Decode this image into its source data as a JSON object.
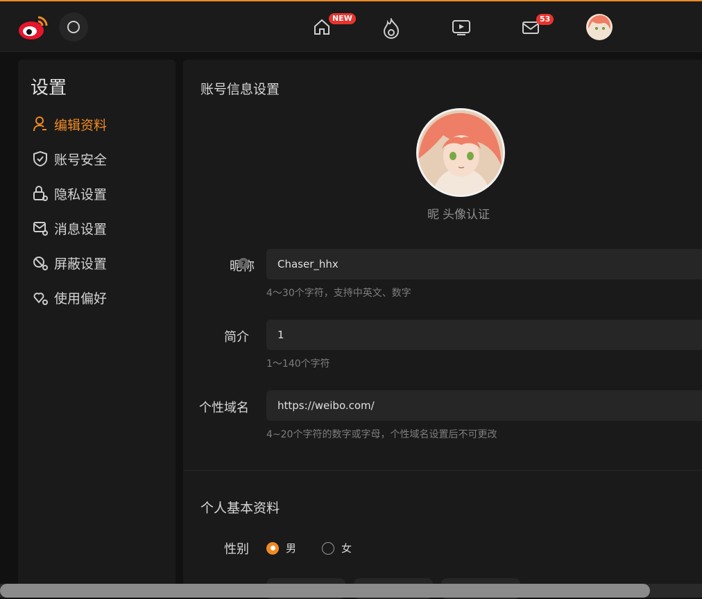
{
  "topbar": {
    "logo_icon": "weibo-logo-icon",
    "search_icon": "search-icon",
    "nav": [
      {
        "name": "home-icon",
        "badge": "NEW"
      },
      {
        "name": "hot-icon",
        "badge": ""
      },
      {
        "name": "video-icon",
        "badge": ""
      },
      {
        "name": "message-icon",
        "badge": "53"
      },
      {
        "name": "user-avatar",
        "badge": ""
      }
    ],
    "accent_color": "#f08a24",
    "badge_color": "#e8342e"
  },
  "sidebar": {
    "title": "设置",
    "items": [
      {
        "label": "编辑资料",
        "icon": "user-icon",
        "active": true
      },
      {
        "label": "账号安全",
        "icon": "shield-icon",
        "active": false
      },
      {
        "label": "隐私设置",
        "icon": "lock-gear-icon",
        "active": false
      },
      {
        "label": "消息设置",
        "icon": "mail-gear-icon",
        "active": false
      },
      {
        "label": "屏蔽设置",
        "icon": "block-gear-icon",
        "active": false
      },
      {
        "label": "使用偏好",
        "icon": "heart-gear-icon",
        "active": false
      }
    ]
  },
  "main": {
    "section_account": "账号信息设置",
    "avatar_caption_left": "昵",
    "avatar_caption": "头像认证",
    "nickname": {
      "label": "昵称",
      "value": "Chaser_hhx",
      "hint": "4～30个字符，支持中英文、数字"
    },
    "bio": {
      "label": "简介",
      "value": "1",
      "hint": "1～140个字符"
    },
    "domain": {
      "label": "个性域名",
      "prefix": "https://weibo.com/",
      "value": "",
      "hint": "4~20个字符的数字或字母，个性域名设置后不可更改"
    },
    "section_basic": "个人基本资料",
    "gender": {
      "label": "性别",
      "options": [
        "男",
        "女"
      ],
      "selected": "男"
    }
  }
}
